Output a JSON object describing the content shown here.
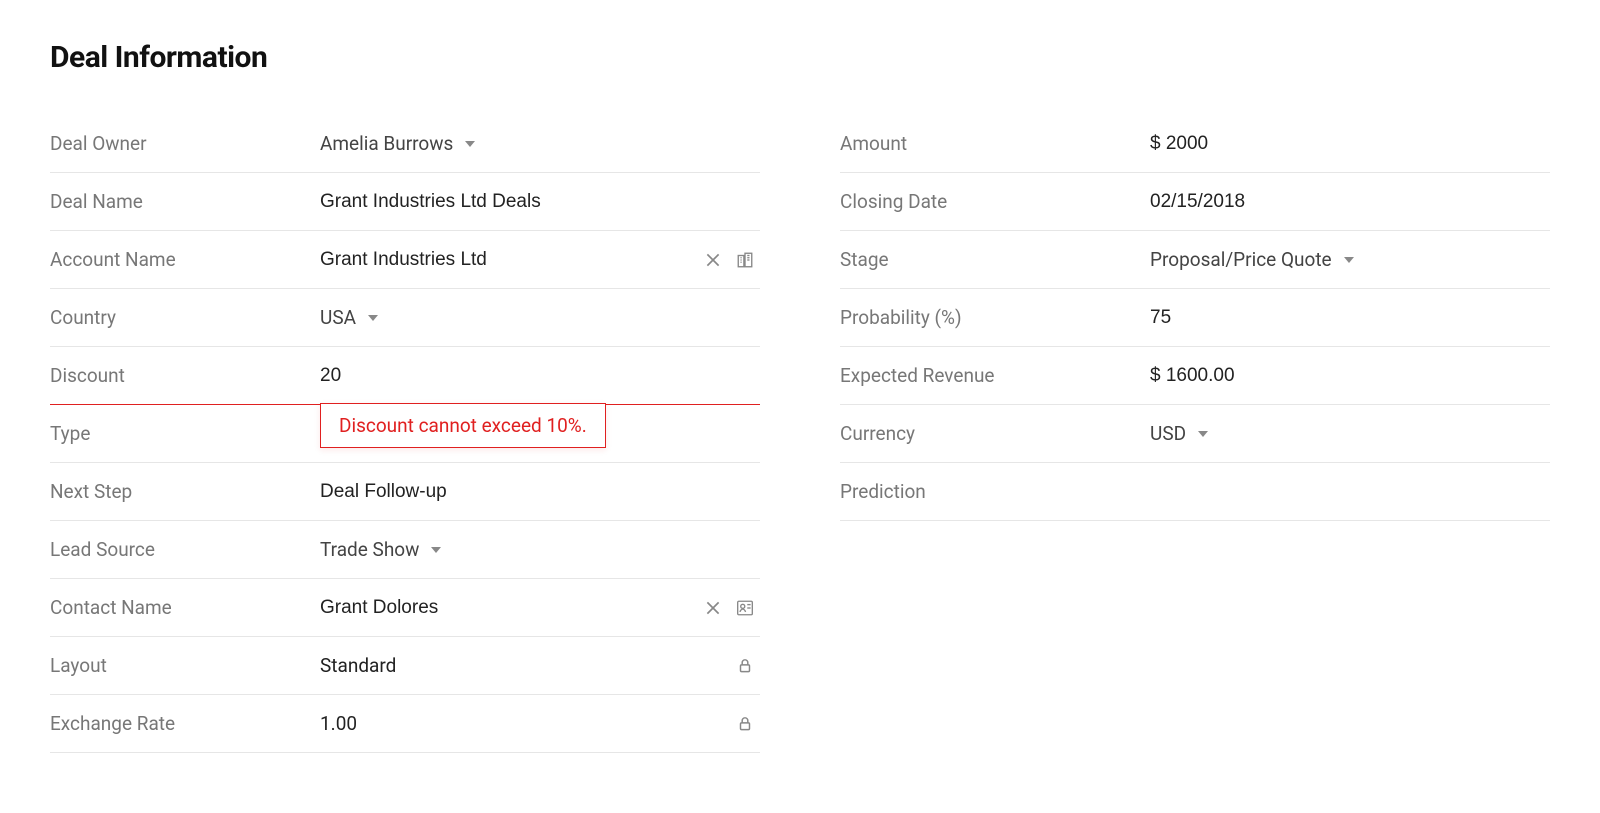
{
  "title": "Deal Information",
  "left": {
    "deal_owner": {
      "label": "Deal Owner",
      "value": "Amelia Burrows"
    },
    "deal_name": {
      "label": "Deal Name",
      "value": "Grant Industries Ltd Deals"
    },
    "account_name": {
      "label": "Account Name",
      "value": "Grant Industries Ltd"
    },
    "country": {
      "label": "Country",
      "value": "USA"
    },
    "discount": {
      "label": "Discount",
      "value": "20",
      "error": "Discount cannot exceed 10%."
    },
    "type": {
      "label": "Type",
      "value": ""
    },
    "next_step": {
      "label": "Next Step",
      "value": "Deal Follow-up"
    },
    "lead_source": {
      "label": "Lead Source",
      "value": "Trade Show"
    },
    "contact_name": {
      "label": "Contact Name",
      "value": "Grant Dolores"
    },
    "layout": {
      "label": "Layout",
      "value": "Standard"
    },
    "exchange_rate": {
      "label": "Exchange Rate",
      "value": "1.00"
    }
  },
  "right": {
    "amount": {
      "label": "Amount",
      "value": "$ 2000"
    },
    "closing_date": {
      "label": "Closing Date",
      "value": "02/15/2018"
    },
    "stage": {
      "label": "Stage",
      "value": "Proposal/Price Quote"
    },
    "probability": {
      "label": "Probability (%)",
      "value": "75"
    },
    "expected_revenue": {
      "label": "Expected Revenue",
      "value": "$ 1600.00"
    },
    "currency": {
      "label": "Currency",
      "value": "USD"
    },
    "prediction": {
      "label": "Prediction",
      "value": ""
    }
  }
}
